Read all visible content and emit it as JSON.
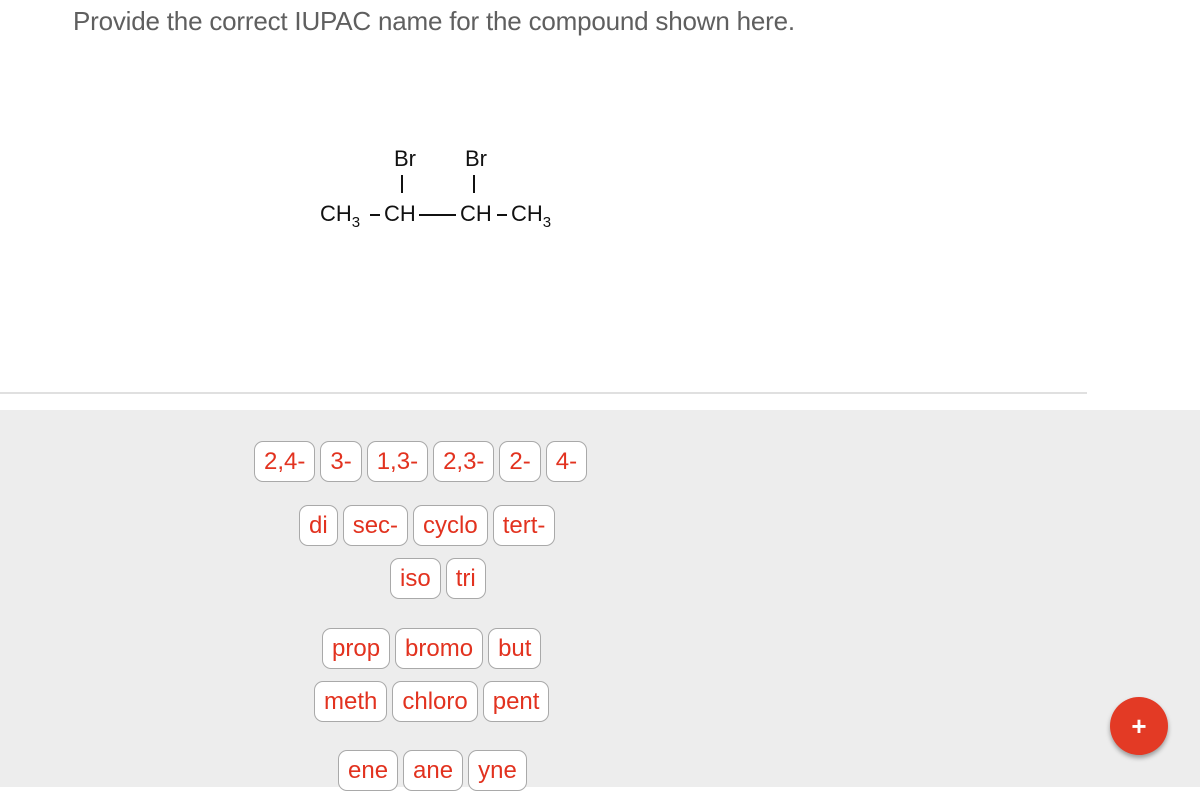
{
  "question": "Provide the correct IUPAC name for the compound shown here.",
  "structure": {
    "substituent_left": "Br",
    "substituent_right": "Br",
    "chain": [
      {
        "group": "CH",
        "sub": "3"
      },
      {
        "group": "CH",
        "sub": ""
      },
      {
        "group": "CH",
        "sub": ""
      },
      {
        "group": "CH",
        "sub": "3"
      }
    ]
  },
  "tile_rows": [
    [
      "2,4-",
      "3-",
      "1,3-",
      "2,3-",
      "2-",
      "4-"
    ],
    [
      "di",
      "sec-",
      "cyclo",
      "tert-"
    ],
    [
      "iso",
      "tri"
    ],
    [
      "prop",
      "bromo",
      "but"
    ],
    [
      "meth",
      "chloro",
      "pent"
    ],
    [
      "ene",
      "ane",
      "yne"
    ]
  ],
  "fab": {
    "icon": "plus-icon",
    "label": "+"
  },
  "colors": {
    "tile_text": "#e2321f",
    "fab": "#e33a25",
    "panel": "#ededed"
  }
}
